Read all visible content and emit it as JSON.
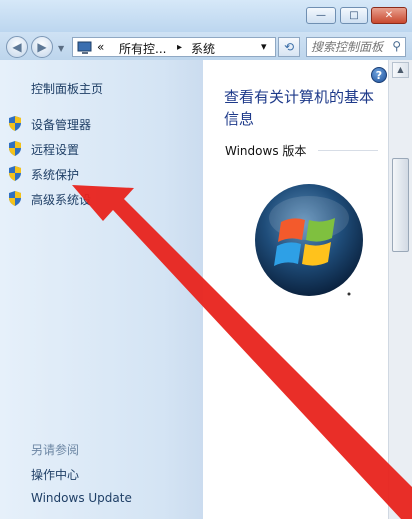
{
  "window": {
    "minimize_glyph": "—",
    "maximize_glyph": "□",
    "close_glyph": "✕"
  },
  "address": {
    "icon": "computer-icon",
    "chevron": "«",
    "crumb1": "所有控...",
    "separator": "▸",
    "crumb2": "系统",
    "dropdown": "▾",
    "refresh_glyph": "⟲",
    "search_placeholder": "搜索控制面板"
  },
  "sidebar": {
    "home": "控制面板主页",
    "items": [
      {
        "label": "设备管理器",
        "icon": "uac-shield-icon"
      },
      {
        "label": "远程设置",
        "icon": "uac-shield-icon"
      },
      {
        "label": "系统保护",
        "icon": "uac-shield-icon"
      },
      {
        "label": "高级系统设",
        "icon": "uac-shield-icon"
      }
    ],
    "see_also": "另请参阅",
    "links": [
      "操作中心",
      "Windows Update"
    ]
  },
  "main": {
    "heading": "查看有关计算机的基本信息",
    "section": "Windows 版本",
    "logo": "windows-logo-icon"
  },
  "help_glyph": "?",
  "annotation": {
    "type": "red-arrow",
    "color": "#e8231c",
    "points_to": "系统保护"
  },
  "colors": {
    "link": "#1f3f66",
    "heading": "#1e3a8a",
    "arrow": "#e8231c"
  }
}
